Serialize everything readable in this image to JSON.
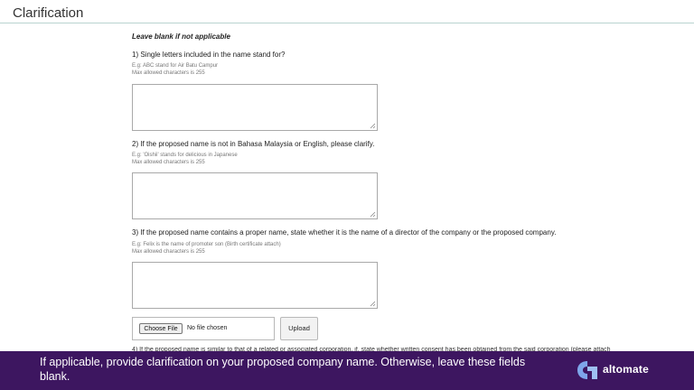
{
  "page": {
    "title": "Clarification"
  },
  "form": {
    "intro": "Leave blank if not applicable",
    "questions": [
      {
        "label": "1) Single letters included in the name stand for?",
        "example": "E.g: ABC stand for Air Batu Campur",
        "limit": "Max allowed characters is 255",
        "value": ""
      },
      {
        "label": "2) If the proposed name is not in Bahasa Malaysia or English, please clarify.",
        "example": "E.g: 'Oishii' stands for delicious in Japanese",
        "limit": "Max allowed characters is 255",
        "value": ""
      },
      {
        "label": "3) If the proposed name contains a proper name, state whether it is the name of a director of the company or the proposed company.",
        "example": "E.g: Felix is the name of promoter son (Birth certificate attach)",
        "limit": "Max allowed characters is 255",
        "value": ""
      }
    ],
    "file_input": {
      "button_label": "Choose File",
      "status": "No file chosen"
    },
    "upload_button": "Upload",
    "q4_partial": "4) If the proposed name is similar to that of a related or associated corporation, if, state whether written consent has been obtained from the said corporation (please attach"
  },
  "banner": {
    "text": "If applicable, provide clarification on your proposed company name. Otherwise, leave these fields blank.",
    "brand": "altomate",
    "color": "#3d1660"
  }
}
